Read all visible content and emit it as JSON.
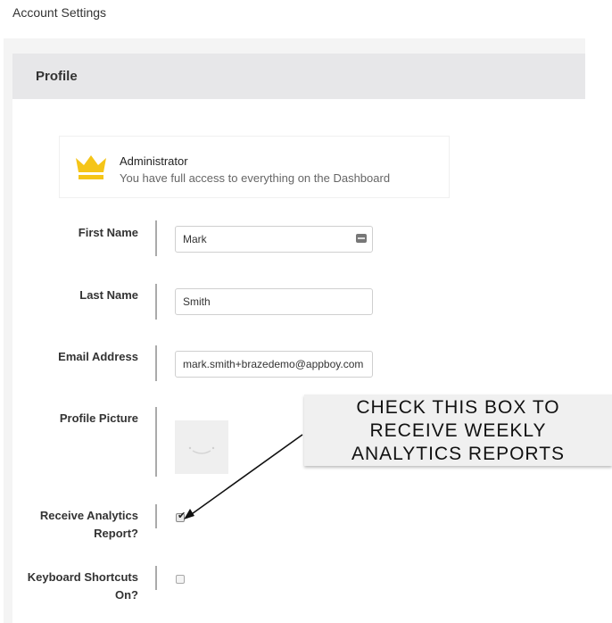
{
  "page": {
    "title": "Account Settings"
  },
  "profile": {
    "header": "Profile",
    "role": {
      "title": "Administrator",
      "description": "You have full access to everything on the Dashboard",
      "icon": "crown-icon",
      "icon_color": "#f5c518"
    },
    "fields": {
      "first_name": {
        "label": "First Name",
        "value": "Mark"
      },
      "last_name": {
        "label": "Last Name",
        "value": "Smith"
      },
      "email": {
        "label": "Email Address",
        "value": "mark.smith+brazedemo@appboy.com"
      },
      "picture": {
        "label": "Profile Picture"
      },
      "analytics": {
        "label_line1": "Receive Analytics",
        "label_line2": "Report?",
        "checked": true
      },
      "shortcuts": {
        "label_line1": "Keyboard Shortcuts",
        "label_line2": "On?",
        "checked": false
      }
    }
  },
  "callout": {
    "line1": "CHECK THIS BOX TO",
    "line2": "RECEIVE WEEKLY",
    "line3": "ANALYTICS REPORTS"
  }
}
